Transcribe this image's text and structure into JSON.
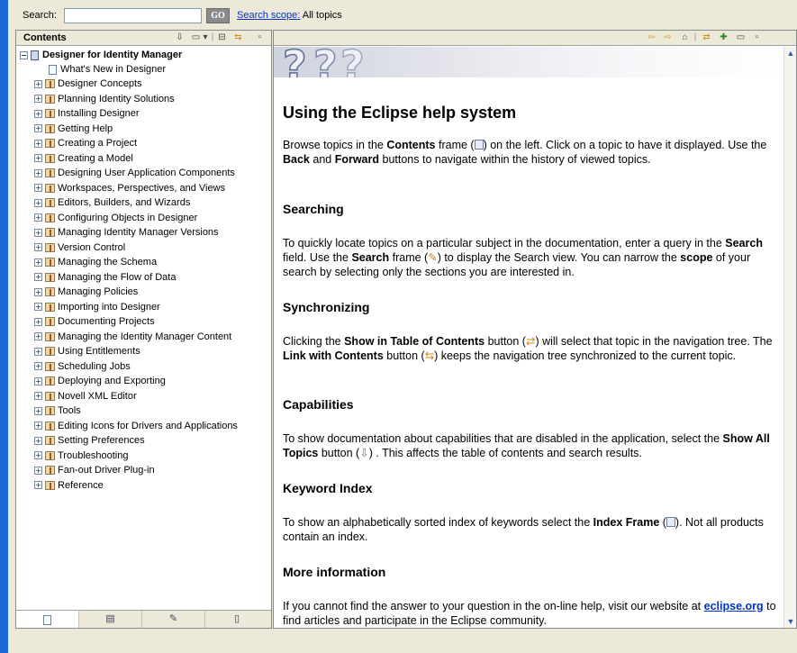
{
  "search": {
    "label": "Search:",
    "value": "",
    "go_label": "GO",
    "scope_link": "Search scope:",
    "scope_value": " All topics"
  },
  "toc": {
    "title": "Contents",
    "root": "Designer for Identity Manager",
    "whats_new": "What's New in Designer",
    "items": [
      "Designer Concepts",
      "Planning Identity Solutions",
      "Installing Designer",
      "Getting Help",
      "Creating a Project",
      "Creating a Model",
      "Designing User Application Components",
      "Workspaces, Perspectives, and Views",
      "Editors, Builders, and Wizards",
      "Configuring Objects in Designer",
      "Managing Identity Manager Versions",
      "Version Control",
      "Managing the Schema",
      "Managing the Flow of Data",
      "Managing Policies",
      "Importing into Designer",
      "Documenting Projects",
      "Managing the Identity Manager Content",
      "Using Entitlements",
      "Scheduling Jobs",
      "Deploying and Exporting",
      "Novell XML Editor",
      "Tools",
      "Editing Icons for Drivers and Applications",
      "Setting Preferences",
      "Troubleshooting",
      "Fan-out Driver Plug-in",
      "Reference"
    ],
    "expand_glyph": "+",
    "collapse_glyph": "−"
  },
  "article": {
    "title": "Using the Eclipse help system",
    "intro": {
      "t1": "Browse topics in the ",
      "b1": "Contents",
      "t2": " frame (",
      "t3": ") on the left. Click on a topic to have it displayed. Use the ",
      "b2": "Back",
      "t4": " and ",
      "b3": "Forward",
      "t5": " buttons to navigate within the history of viewed topics."
    },
    "searching": {
      "heading": "Searching",
      "t1": "To quickly locate topics on a particular subject in the documentation, enter a query in the ",
      "b1": "Search",
      "t2": " field. Use the ",
      "b2": "Search",
      "t3": " frame (",
      "t4": ") to display the Search view. You can narrow the ",
      "b3": "scope",
      "t5": " of your search by selecting only the sections you are interested in."
    },
    "sync": {
      "heading": "Synchronizing",
      "t1": "Clicking the ",
      "b1": "Show in Table of Contents",
      "t2": " button (",
      "t3": ") will select that topic in the navigation tree. The ",
      "b2": "Link with Contents",
      "t4": " button (",
      "t5": ") keeps the navigation tree synchronized to the current topic."
    },
    "capabilities": {
      "heading": "Capabilities",
      "t1": "To show documentation about capabilities that are disabled in the application, select the ",
      "b1": "Show All Topics",
      "t2": " button (",
      "t3": ") . This affects the table of contents and search results."
    },
    "keyword": {
      "heading": "Keyword Index",
      "t1": "To show an alphabetically sorted index of keywords select the ",
      "b1": "Index Frame",
      "t2": " (",
      "t3": "). Not all products contain an index."
    },
    "more": {
      "heading": "More information",
      "t1": "If you cannot find the answer to your question in the on-line help, visit our website at ",
      "link": "eclipse.org",
      "t2": " to find articles and participate in the Eclipse community."
    }
  },
  "colors": {
    "window_bg": "#ece9d8",
    "link": "#0033cc",
    "left_strip": "#1a6bd6",
    "nav_arrows": "#d89a1a"
  }
}
